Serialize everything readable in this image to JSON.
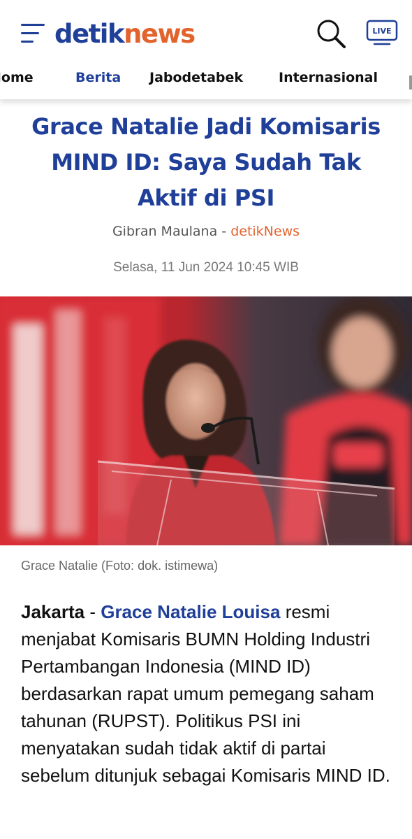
{
  "header": {
    "logo_part1": "detik",
    "logo_part2": "news",
    "live_label": "LIVE",
    "brand_blue": "#1f3f98",
    "brand_orange": "#e3632d"
  },
  "nav": {
    "items": [
      {
        "label": "Home",
        "active": false
      },
      {
        "label": "Berita",
        "active": true
      },
      {
        "label": "Jabodetabek",
        "active": false
      },
      {
        "label": "Internasional",
        "active": false
      }
    ]
  },
  "article": {
    "title": "Grace Natalie Jadi Komisaris MIND ID: Saya Sudah Tak Aktif di PSI",
    "author": "Gibran Maulana",
    "byline_separator": "-",
    "source": "detikNews",
    "date": "Selasa, 11 Jun 2024 10:45 WIB",
    "photo_caption": "Grace Natalie (Foto: dok. istimewa)",
    "dateline": "Jakarta",
    "dateline_separator": "-",
    "person_link": "Grace Natalie Louisa",
    "body_rest": "resmi menjabat Komisaris BUMN Holding Industri Pertambangan Indonesia (MIND ID) berdasarkan rapat umum pemegang saham tahunan (RUPST). Politikus PSI ini menyatakan sudah tidak aktif di partai sebelum ditunjuk sebagai Komisaris MIND ID."
  }
}
